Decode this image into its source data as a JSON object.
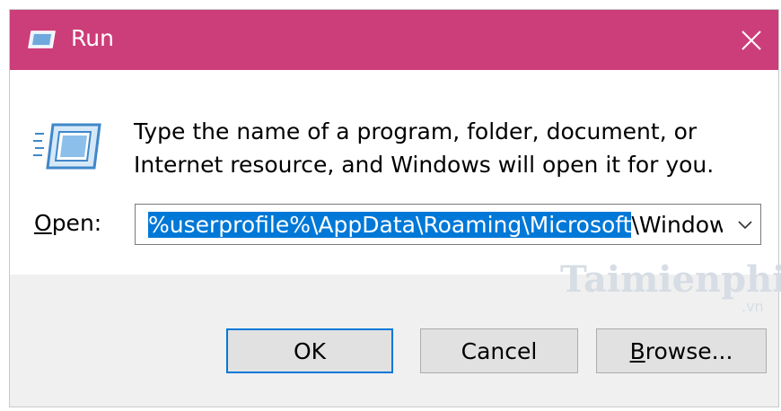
{
  "window": {
    "title": "Run",
    "accent_color": "#cc3e79",
    "title_icon": "run-icon",
    "close_icon": "close-icon"
  },
  "dialog": {
    "description": "Type the name of a program, folder, document, or Internet resource, and Windows will open it for you.",
    "open_label_mnemonic": "O",
    "open_label_rest": "pen:",
    "input": {
      "selected_text": "%userprofile%\\AppData\\Roaming\\Microsoft",
      "unselected_text": "\\Windows\\",
      "selection_color": "#0078d7"
    }
  },
  "buttons": {
    "ok_label": "OK",
    "cancel_label": "Cancel",
    "browse_mnemonic": "B",
    "browse_rest": "rowse..."
  },
  "watermark": {
    "main": "Taimienphi",
    "sub": ".vn"
  }
}
